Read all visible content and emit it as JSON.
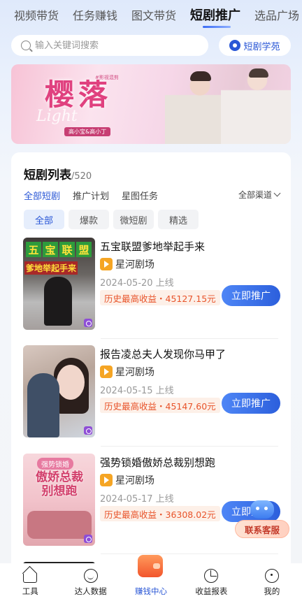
{
  "top_tabs": [
    "视频带货",
    "任务赚钱",
    "图文带货",
    "短剧推广",
    "选品广场"
  ],
  "active_top_tab": "短剧推广",
  "search": {
    "placeholder": "输入关键词搜索"
  },
  "academy_label": "短剧学苑",
  "banner": {
    "title": "樱落",
    "subtitle": "Light",
    "tag": "#影视混剪",
    "cast": "高小宝&高小丁"
  },
  "list": {
    "title": "短剧列表",
    "count": "/520",
    "filter_tabs": [
      "全部短剧",
      "推广计划",
      "星图任务"
    ],
    "channel_label": "全部渠道",
    "chips": [
      "全部",
      "爆款",
      "微短剧",
      "精选"
    ]
  },
  "items": [
    {
      "thumb_caption_blocks": [
        "五",
        "宝",
        "联",
        "盟"
      ],
      "thumb_caption_line": "爹地举起手来",
      "title": "五宝联盟爹地举起手来",
      "source": "星河剧场",
      "date": "2024-05-20 上线",
      "income": "历史最高收益・45127.15元",
      "button": "立即推广"
    },
    {
      "title": "报告凌总夫人发现你马甲了",
      "source": "星河剧场",
      "date": "2024-05-15 上线",
      "income": "历史最高收益・45147.60元",
      "button": "立即推广"
    },
    {
      "thumb_tag": "强势锁婚",
      "thumb_caption": "傲娇总裁别想跑",
      "title": "强势锁婚傲娇总裁别想跑",
      "source": "星河剧场",
      "date": "2024-05-17 上线",
      "income": "历史最高收益・36308.02元",
      "button": "立即推广"
    }
  ],
  "support_label": "联系客服",
  "nav": [
    {
      "label": "工具",
      "icon": "home-icon"
    },
    {
      "label": "达人数据",
      "icon": "face-icon"
    },
    {
      "label": "赚钱中心",
      "icon": "wallet-icon"
    },
    {
      "label": "收益报表",
      "icon": "pie-chart-icon"
    },
    {
      "label": "我的",
      "icon": "profile-icon"
    }
  ],
  "colors": {
    "accent": "#2a57d6",
    "income": "#e8542b",
    "wallet": "#f2552c"
  }
}
